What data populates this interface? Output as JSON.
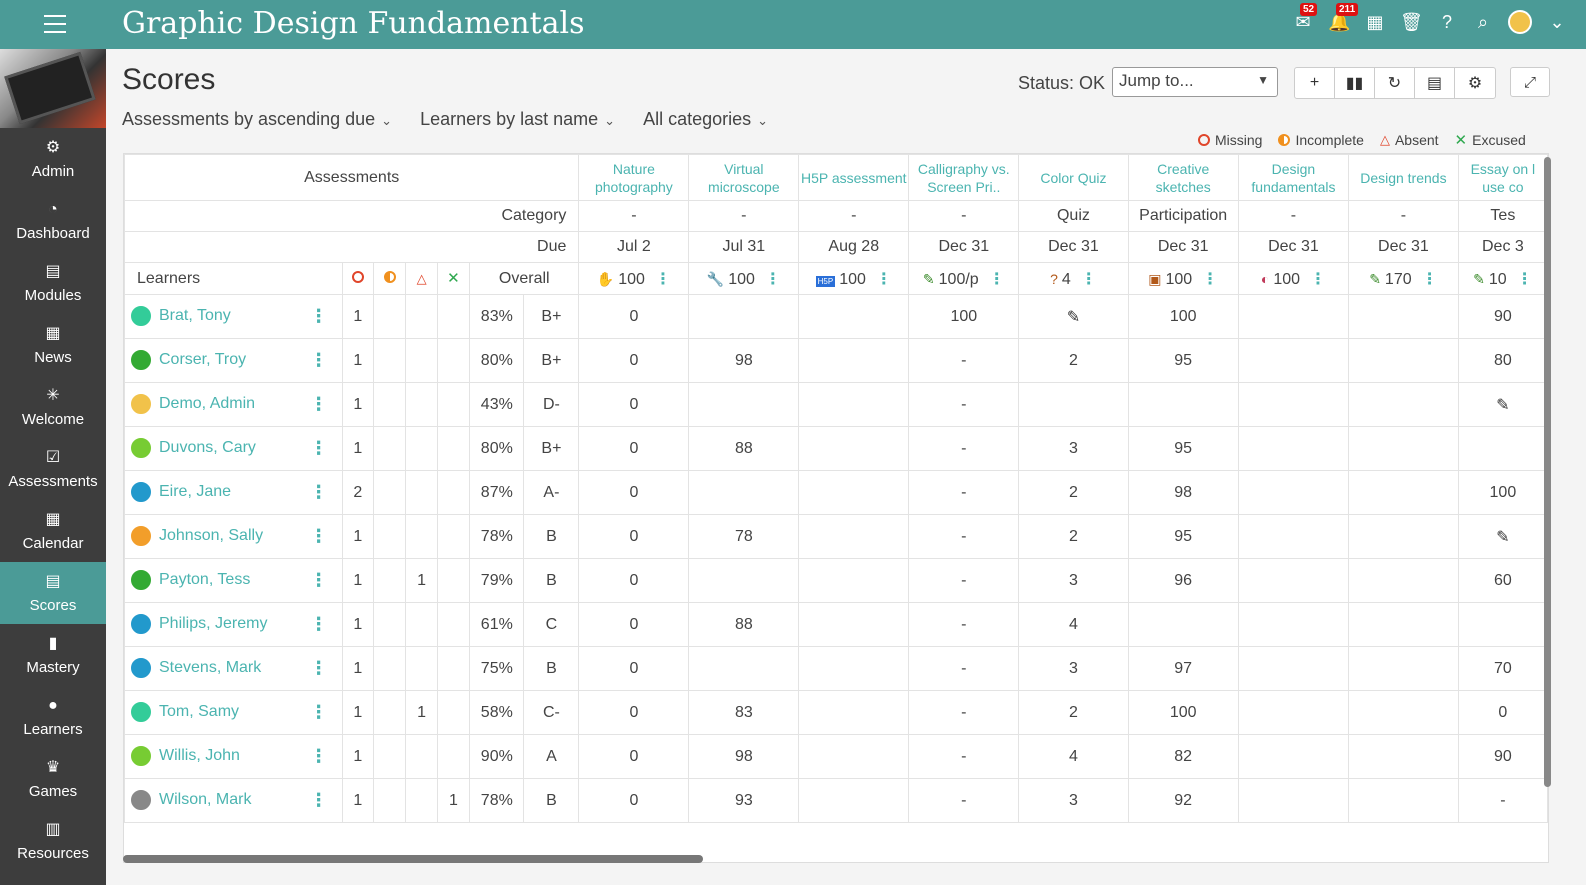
{
  "app": {
    "title": "Graphic Design Fundamentals",
    "mail_count": "52",
    "notif_count": "211"
  },
  "sidebar": {
    "items": [
      {
        "label": "Admin",
        "icon": "⚙"
      },
      {
        "label": "Dashboard",
        "icon": "◔"
      },
      {
        "label": "Modules",
        "icon": "▤"
      },
      {
        "label": "News",
        "icon": "▦"
      },
      {
        "label": "Welcome",
        "icon": "✳"
      },
      {
        "label": "Assessments",
        "icon": "☑"
      },
      {
        "label": "Calendar",
        "icon": "▦"
      },
      {
        "label": "Scores",
        "icon": "▤"
      },
      {
        "label": "Mastery",
        "icon": "▮"
      },
      {
        "label": "Learners",
        "icon": "●"
      },
      {
        "label": "Games",
        "icon": "♛"
      },
      {
        "label": "Resources",
        "icon": "▥"
      }
    ]
  },
  "page": {
    "title": "Scores",
    "status": "Status: OK",
    "jump_to": "Jump to..."
  },
  "filters": [
    "Assessments by ascending due",
    "Learners by last name",
    "All categories"
  ],
  "legend": {
    "missing": "Missing",
    "incomplete": "Incomplete",
    "absent": "Absent",
    "excused": "Excused"
  },
  "grid": {
    "assessments_label": "Assessments",
    "category_label": "Category",
    "due_label": "Due",
    "learners_label": "Learners",
    "overall_label": "Overall",
    "assessments": [
      {
        "title": "Nature photography",
        "category": "-",
        "due": "Jul 2",
        "points": "100",
        "icon": "✋",
        "color": "#3a6fd8"
      },
      {
        "title": "Virtual microscope",
        "category": "-",
        "due": "Jul 31",
        "points": "100",
        "icon": "🔧",
        "color": "#3a8a2a"
      },
      {
        "title": "H5P assessment",
        "category": "-",
        "due": "Aug 28",
        "points": "100",
        "icon": "H5P",
        "color": "#2a6fd8"
      },
      {
        "title": "Calligraphy vs. Screen Pri..",
        "category": "-",
        "due": "Dec 31",
        "points": "100/p",
        "icon": "✎",
        "color": "#3a8a2a"
      },
      {
        "title": "Color Quiz",
        "category": "Quiz",
        "due": "Dec 31",
        "points": "4",
        "icon": "?",
        "color": "#b2591a"
      },
      {
        "title": "Creative sketches",
        "category": "Participation",
        "due": "Dec 31",
        "points": "100",
        "icon": "▣",
        "color": "#b2591a"
      },
      {
        "title": "Design fundamentals",
        "category": "-",
        "due": "Dec 31",
        "points": "100",
        "icon": "◐",
        "color": "#c03a5a"
      },
      {
        "title": "Design trends",
        "category": "-",
        "due": "Dec 31",
        "points": "170",
        "icon": "✎",
        "color": "#3a8a2a"
      },
      {
        "title": "Essay on l use co",
        "category": "Tes",
        "due": "Dec 3",
        "points": "10",
        "icon": "✎",
        "color": "#3a8a2a"
      }
    ],
    "learners": [
      {
        "name": "Brat, Tony",
        "missing": "1",
        "incomplete": "",
        "absent": "",
        "excused": "",
        "pct": "83%",
        "grade": "B+",
        "scores": [
          "0",
          "",
          "",
          "100",
          "✎",
          "100",
          "",
          "",
          "90"
        ],
        "color": "#3c9"
      },
      {
        "name": "Corser, Troy",
        "missing": "1",
        "incomplete": "",
        "absent": "",
        "excused": "",
        "pct": "80%",
        "grade": "B+",
        "scores": [
          "0",
          "98",
          "",
          "-",
          "2",
          "95",
          "",
          "",
          "80"
        ],
        "color": "#3a3"
      },
      {
        "name": "Demo, Admin",
        "missing": "1",
        "incomplete": "",
        "absent": "",
        "excused": "",
        "pct": "43%",
        "grade": "D-",
        "scores": [
          "0",
          "",
          "",
          "-",
          "",
          "",
          "",
          "",
          "✎"
        ],
        "color": "#f1c24a"
      },
      {
        "name": "Duvons, Cary",
        "missing": "1",
        "incomplete": "",
        "absent": "",
        "excused": "",
        "pct": "80%",
        "grade": "B+",
        "scores": [
          "0",
          "88",
          "",
          "-",
          "3",
          "95",
          "",
          "",
          ""
        ],
        "color": "#7c3"
      },
      {
        "name": "Eire, Jane",
        "missing": "2",
        "incomplete": "",
        "absent": "",
        "excused": "",
        "pct": "87%",
        "grade": "A-",
        "scores": [
          "0",
          "",
          "",
          "-",
          "2",
          "98",
          "",
          "",
          "100"
        ],
        "color": "#29c"
      },
      {
        "name": "Johnson, Sally",
        "missing": "1",
        "incomplete": "",
        "absent": "",
        "excused": "",
        "pct": "78%",
        "grade": "B",
        "scores": [
          "0",
          "78",
          "",
          "-",
          "2",
          "95",
          "",
          "",
          "✎"
        ],
        "color": "#f29e2a"
      },
      {
        "name": "Payton, Tess",
        "missing": "1",
        "incomplete": "",
        "absent": "1",
        "excused": "",
        "pct": "79%",
        "grade": "B",
        "scores": [
          "0",
          "",
          "",
          "-",
          "3",
          "96",
          "",
          "",
          "60"
        ],
        "color": "#3a3"
      },
      {
        "name": "Philips, Jeremy",
        "missing": "1",
        "incomplete": "",
        "absent": "",
        "excused": "",
        "pct": "61%",
        "grade": "C",
        "scores": [
          "0",
          "88",
          "",
          "-",
          "4",
          "",
          "",
          "",
          ""
        ],
        "color": "#29c"
      },
      {
        "name": "Stevens, Mark",
        "missing": "1",
        "incomplete": "",
        "absent": "",
        "excused": "",
        "pct": "75%",
        "grade": "B",
        "scores": [
          "0",
          "",
          "",
          "-",
          "3",
          "97",
          "",
          "",
          "70"
        ],
        "color": "#29c"
      },
      {
        "name": "Tom, Samy",
        "missing": "1",
        "incomplete": "",
        "absent": "1",
        "excused": "",
        "pct": "58%",
        "grade": "C-",
        "scores": [
          "0",
          "83",
          "",
          "-",
          "2",
          "100",
          "",
          "",
          "0"
        ],
        "color": "#3c9"
      },
      {
        "name": "Willis, John",
        "missing": "1",
        "incomplete": "",
        "absent": "",
        "excused": "",
        "pct": "90%",
        "grade": "A",
        "scores": [
          "0",
          "98",
          "",
          "-",
          "4",
          "82",
          "",
          "",
          "90"
        ],
        "color": "#7c3"
      },
      {
        "name": "Wilson, Mark",
        "missing": "1",
        "incomplete": "",
        "absent": "",
        "excused": "1",
        "pct": "78%",
        "grade": "B",
        "scores": [
          "0",
          "93",
          "",
          "-",
          "3",
          "92",
          "",
          "",
          "-"
        ],
        "color": "#888"
      }
    ]
  }
}
